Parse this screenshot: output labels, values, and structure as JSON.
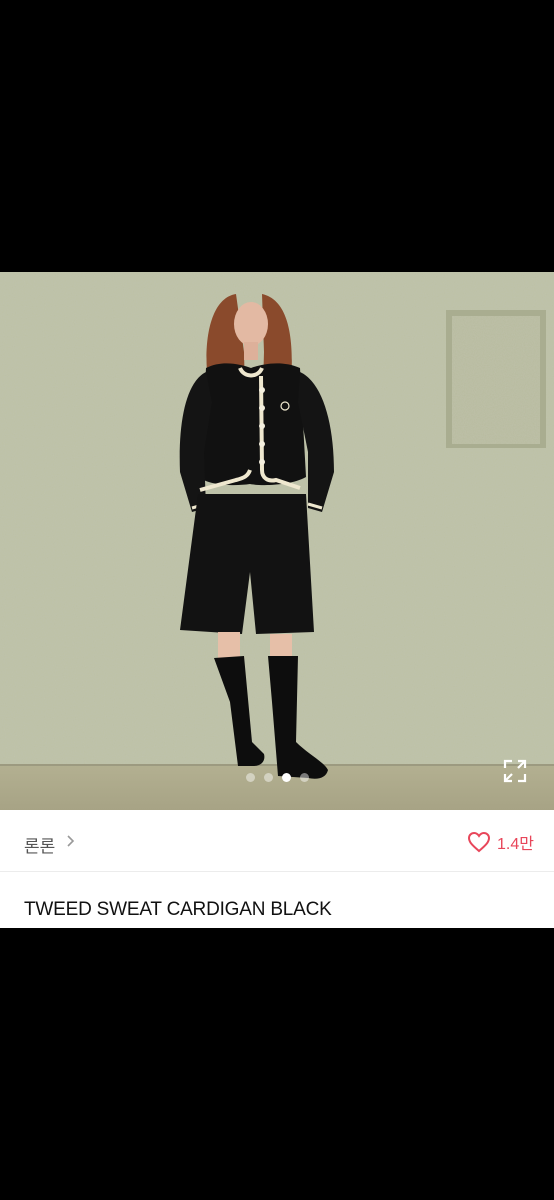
{
  "product": {
    "title": "TWEED SWEAT CARDIGAN BLACK",
    "shop_name": "론론",
    "like_count": "1.4만",
    "image_alt": "Model wearing black tweed sweat cardigan with cream trim, black shorts and knee-high boots"
  },
  "gallery": {
    "total_images": 4,
    "active_index": 2
  },
  "colors": {
    "like_accent": "#e8465a",
    "wall": "#b9bca1"
  },
  "icons": {
    "expand": "expand-icon",
    "chevron": "chevron-right-icon",
    "heart": "heart-outline-icon"
  }
}
